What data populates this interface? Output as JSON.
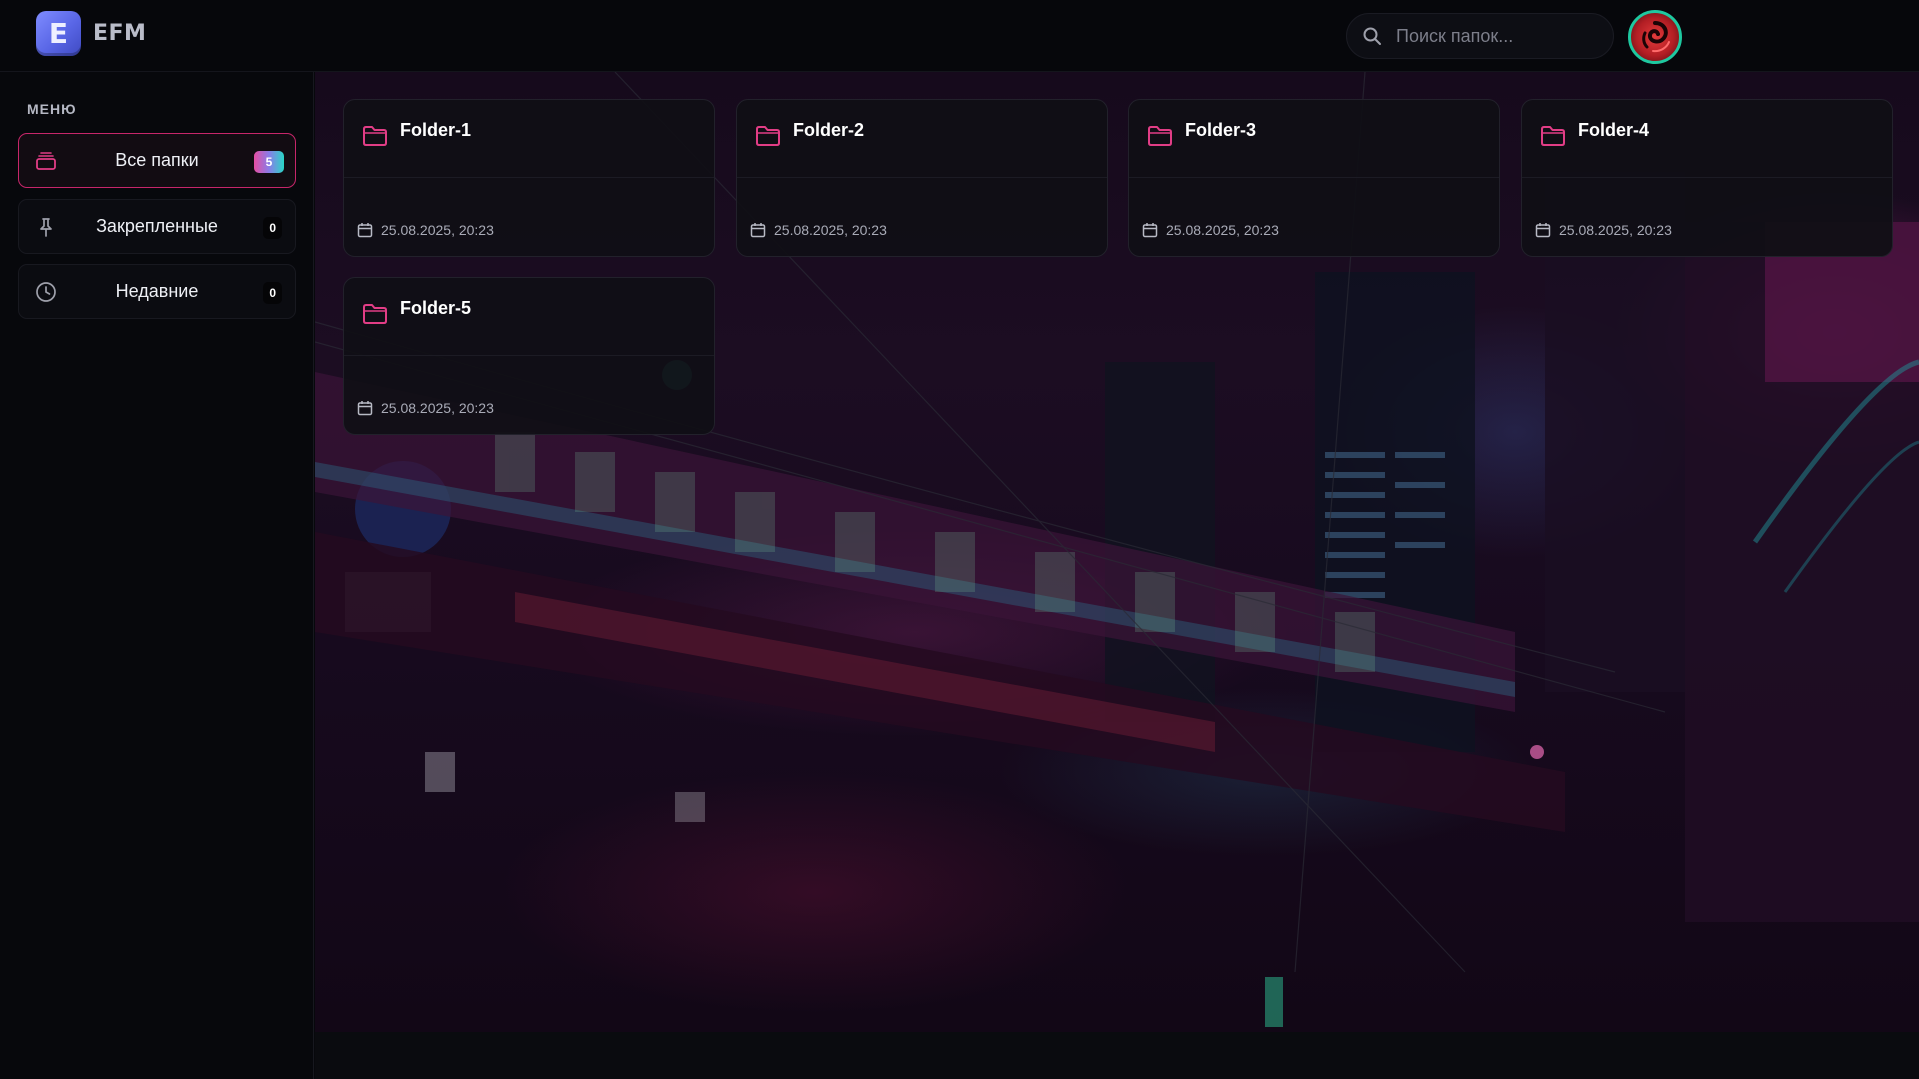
{
  "app": {
    "logo_letter": "E",
    "name": "EFM"
  },
  "search": {
    "placeholder": "Поиск папок..."
  },
  "sidebar": {
    "title": "МЕНЮ",
    "items": [
      {
        "label": "Все папки",
        "count": "5",
        "icon": "stack-icon",
        "active": true
      },
      {
        "label": "Закрепленные",
        "count": "0",
        "icon": "pin-icon",
        "active": false
      },
      {
        "label": "Недавние",
        "count": "0",
        "icon": "clock-icon",
        "active": false
      }
    ]
  },
  "folders": [
    {
      "name": "Folder-1",
      "date": "25.08.2025, 20:23"
    },
    {
      "name": "Folder-2",
      "date": "25.08.2025, 20:23"
    },
    {
      "name": "Folder-3",
      "date": "25.08.2025, 20:23"
    },
    {
      "name": "Folder-4",
      "date": "25.08.2025, 20:23"
    },
    {
      "name": "Folder-5",
      "date": "25.08.2025, 20:23"
    }
  ],
  "colors": {
    "accent_pink": "#c7266a",
    "folder_icon": "#e23d86",
    "avatar_ring": "#1ec8a0",
    "badge_gradient": [
      "#e54ea2",
      "#8a7ce8",
      "#29d6c6"
    ]
  }
}
